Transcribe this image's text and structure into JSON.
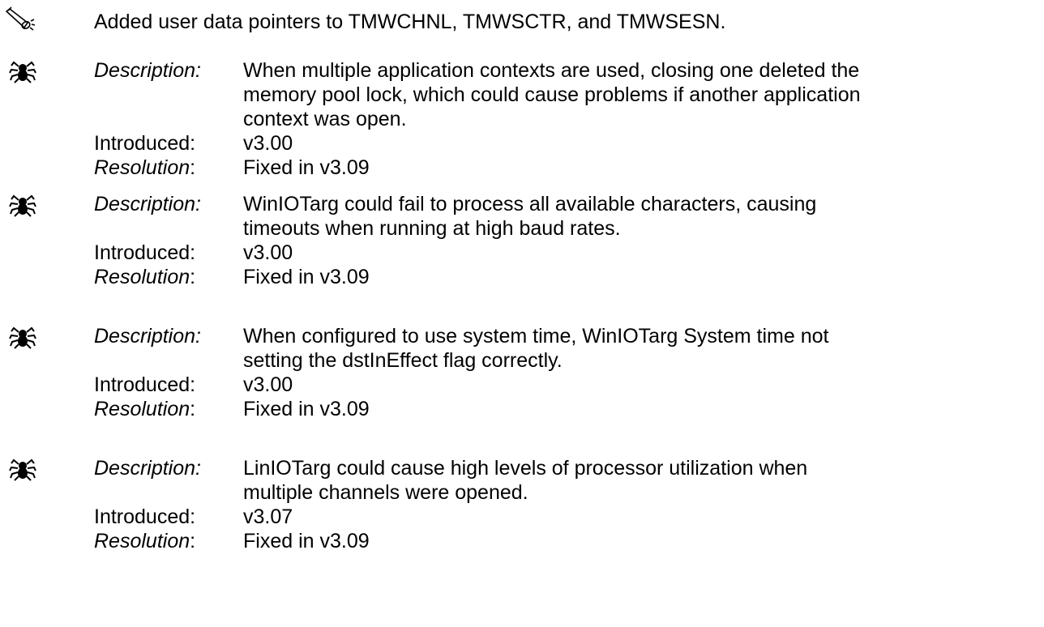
{
  "feature": {
    "icon": "megaphone-icon",
    "text": "Added user data pointers to TMWCHNL, TMWSCTR, and TMWSESN."
  },
  "labels": {
    "description": "Description:",
    "introduced": "Introduced:",
    "resolution": "Resolution",
    "colon": ":"
  },
  "bugs": [
    {
      "icon": "bug-icon",
      "description_lines": [
        "When multiple application contexts are used, closing one deleted the",
        "memory pool lock, which could cause problems  if another application",
        "context was open."
      ],
      "introduced": "v3.00",
      "resolution": "Fixed in v3.09"
    },
    {
      "icon": "bug-icon",
      "description_lines": [
        "WinIOTarg could fail to process all available characters, causing",
        "timeouts when running at high baud rates."
      ],
      "introduced": "v3.00",
      "resolution": "Fixed in v3.09"
    },
    {
      "icon": "bug-icon",
      "description_lines": [
        "When configured to use system time, WinIOTarg System time not",
        "setting the dstInEffect flag correctly."
      ],
      "introduced": "v3.00",
      "resolution": "Fixed in v3.09"
    },
    {
      "icon": "bug-icon",
      "description_lines": [
        "LinIOTarg could cause high levels of processor utilization when",
        "multiple channels were opened."
      ],
      "introduced": "v3.07",
      "resolution": "Fixed in v3.09"
    }
  ]
}
